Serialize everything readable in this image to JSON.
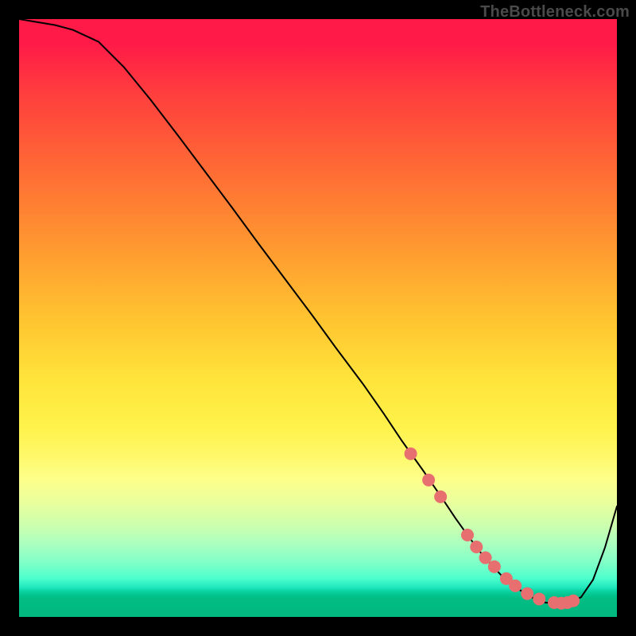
{
  "watermark": "TheBottleneck.com",
  "chart_data": {
    "type": "line",
    "title": "",
    "xlabel": "",
    "ylabel": "",
    "xlim": [
      0,
      100
    ],
    "ylim": [
      0,
      100
    ],
    "curve_x": [
      0,
      3,
      6,
      9,
      13.3,
      17.5,
      22,
      26.6,
      31.1,
      35.6,
      40,
      44.5,
      49,
      53,
      57.5,
      61,
      64,
      67.5,
      71,
      73,
      75,
      77,
      79,
      81,
      83,
      85,
      86.5,
      88,
      90,
      92,
      94,
      96,
      98,
      100
    ],
    "curve_y": [
      100,
      99.5,
      99,
      98.2,
      96.2,
      92,
      86.5,
      80.5,
      74.5,
      68.5,
      62.5,
      56.5,
      50.5,
      45,
      39,
      34,
      29.5,
      24.6,
      19.5,
      16.5,
      13.7,
      11,
      8.7,
      6.6,
      5,
      3.7,
      2.9,
      2.4,
      2.3,
      2.4,
      3.3,
      6.2,
      11.6,
      18.5
    ],
    "dots": {
      "x": [
        65.5,
        68.5,
        70.5,
        75.0,
        76.5,
        78.0,
        79.5,
        81.5,
        83.0,
        85.0,
        87.0,
        89.5,
        90.7,
        91.7,
        92.7
      ],
      "y": [
        27.3,
        22.9,
        20.1,
        13.7,
        11.7,
        9.9,
        8.4,
        6.4,
        5.2,
        3.9,
        3.0,
        2.4,
        2.3,
        2.4,
        2.7
      ],
      "color": "#e76f6f",
      "radius": 8
    },
    "curve_color": "#000000",
    "curve_width": 2
  }
}
